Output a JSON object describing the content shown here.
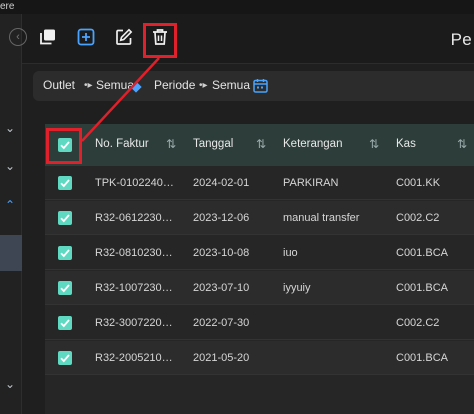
{
  "os_bar": {
    "text": "ere"
  },
  "toolbar": {
    "title": "Pe",
    "icons": [
      "back-icon",
      "copy-icon",
      "add-icon",
      "edit-icon",
      "delete-icon"
    ]
  },
  "filters": {
    "outlet_label": "Outlet",
    "outlet_value": "Semua",
    "periode_label": "Periode",
    "periode_value": "Semua"
  },
  "table": {
    "headers": [
      "No. Faktur",
      "Tanggal",
      "Keterangan",
      "Kas"
    ],
    "rows": [
      {
        "no_faktur": "TPK-0102240…",
        "tanggal": "2024-02-01",
        "keterangan": "PARKIRAN",
        "kas": "C001.KK",
        "checked": true
      },
      {
        "no_faktur": "R32-0612230…",
        "tanggal": "2023-12-06",
        "keterangan": "manual transfer",
        "kas": "C002.C2",
        "checked": true
      },
      {
        "no_faktur": "R32-0810230…",
        "tanggal": "2023-10-08",
        "keterangan": "iuo",
        "kas": "C001.BCA",
        "checked": true
      },
      {
        "no_faktur": "R32-1007230…",
        "tanggal": "2023-07-10",
        "keterangan": "iyyuiy",
        "kas": "C001.BCA",
        "checked": true
      },
      {
        "no_faktur": "R32-3007220…",
        "tanggal": "2022-07-30",
        "keterangan": "",
        "kas": "C002.C2",
        "checked": true
      },
      {
        "no_faktur": "R32-2005210…",
        "tanggal": "2021-05-20",
        "keterangan": "",
        "kas": "C001.BCA",
        "checked": true
      }
    ]
  },
  "colors": {
    "accent": "#5fd9c1",
    "annotation": "#e0202a",
    "header_bg": "#2c3d3a",
    "add_icon": "#4aa3ff"
  }
}
